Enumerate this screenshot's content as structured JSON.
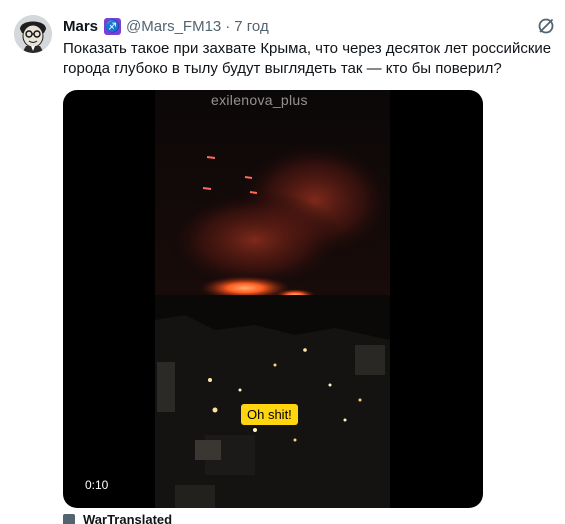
{
  "tweet": {
    "author": {
      "display_name": "Mars",
      "badge_symbol": "♐",
      "handle": "@Mars_FM13",
      "separator": "·",
      "time": "7 год"
    },
    "text": "Показать такое при захвате Крыма, что через десяток лет российские города глубоко в тылу будут выглядеть так — кто бы поверил?",
    "media": {
      "watermark": "exilenova_plus",
      "caption": "Oh shit!",
      "duration": "0:10"
    }
  },
  "next_tweet": {
    "display_name": "WarTranslated"
  },
  "colors": {
    "text": "#0f1419",
    "secondary": "#536471",
    "badge": "#7b3fd6",
    "caption_bg": "#ffd50f",
    "media_bg": "#000000",
    "fire": "#ff5a1f"
  },
  "icons": {
    "avatar": "avatar-cartoon-icon",
    "badge": "sagittarius-badge-icon",
    "grok": "grok-icon"
  }
}
